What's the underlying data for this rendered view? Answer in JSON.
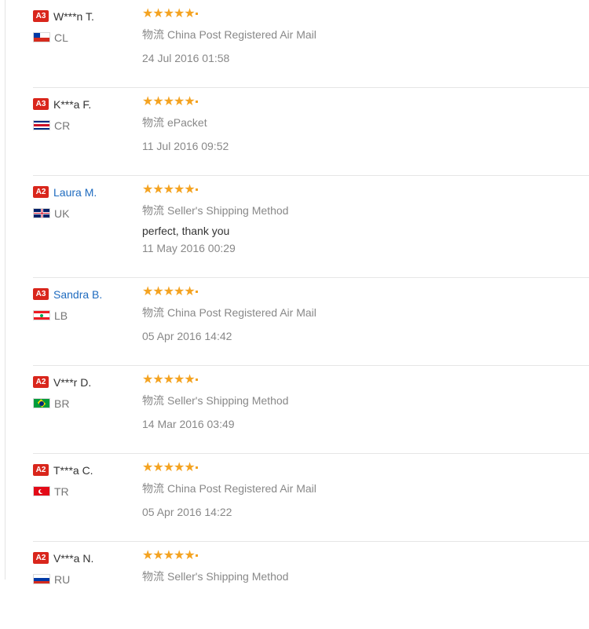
{
  "logistics_label": "物流",
  "reviews": [
    {
      "level": "A3",
      "name": "W***n T.",
      "country": "CL",
      "flag": "flag-cl-icon",
      "stars": 5,
      "shipping": "China Post Registered Air Mail",
      "comment": "",
      "date": "24 Jul 2016 01:58"
    },
    {
      "level": "A3",
      "name": "K***a F.",
      "country": "CR",
      "flag": "flag-cr-icon",
      "stars": 5,
      "shipping": "ePacket",
      "comment": "",
      "date": "11 Jul 2016 09:52"
    },
    {
      "level": "A2",
      "name": "Laura M.",
      "country": "UK",
      "flag": "flag-uk-icon",
      "stars": 5,
      "shipping": "Seller's Shipping Method",
      "comment": "perfect, thank you",
      "date": "11 May 2016 00:29"
    },
    {
      "level": "A3",
      "name": "Sandra B.",
      "country": "LB",
      "flag": "flag-lb-icon",
      "stars": 5,
      "shipping": "China Post Registered Air Mail",
      "comment": "",
      "date": "05 Apr 2016 14:42"
    },
    {
      "level": "A2",
      "name": "V***r D.",
      "country": "BR",
      "flag": "flag-br-icon",
      "stars": 5,
      "shipping": "Seller's Shipping Method",
      "comment": "",
      "date": "14 Mar 2016 03:49"
    },
    {
      "level": "A2",
      "name": "T***a C.",
      "country": "TR",
      "flag": "flag-tr-icon",
      "stars": 5,
      "shipping": "China Post Registered Air Mail",
      "comment": "",
      "date": "05 Apr 2016 14:22"
    },
    {
      "level": "A2",
      "name": "V***a N.",
      "country": "RU",
      "flag": "flag-ru-icon",
      "stars": 5,
      "shipping": "Seller's Shipping Method",
      "comment": "",
      "date": ""
    }
  ],
  "colors": {
    "badge": "#d9261c",
    "star": "#f4a321",
    "link": "#1e6bbf"
  }
}
